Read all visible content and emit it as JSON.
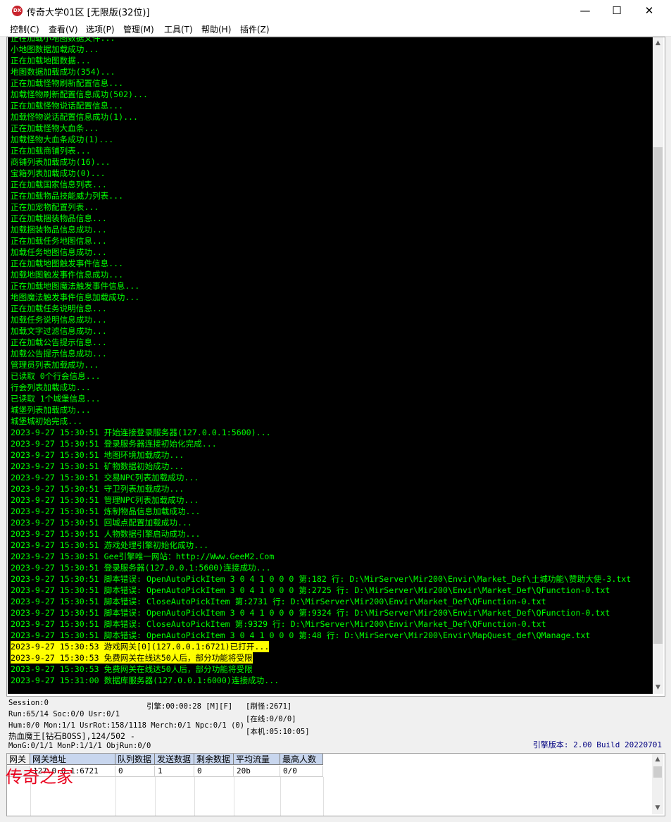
{
  "window": {
    "title": "传奇大学01区 [无限版(32位)]",
    "icon_name": "app-logo-icon",
    "icon_text": "DX",
    "minimize": "—",
    "maximize": "☐",
    "close": "✕"
  },
  "menu": [
    "控制(C)",
    "查看(V)",
    "选项(P)",
    "管理(M)",
    "工具(T)",
    "帮助(H)",
    "插件(Z)"
  ],
  "console_lines": [
    "正在加载小地图数据文件...",
    "小地图数据加载成功...",
    "正在加载地图数据...",
    "地图数据加载成功(354)...",
    "正在加载怪物刷新配置信息...",
    "加载怪物刷新配置信息成功(502)...",
    "正在加载怪物说话配置信息...",
    "加载怪物说话配置信息成功(1)...",
    "正在加载怪物大血条...",
    "加载怪物大血条成功(1)...",
    "正在加载商铺列表...",
    "商铺列表加载成功(16)...",
    "宝箱列表加载成功(0)...",
    "正在加载国家信息列表...",
    "正在加载物品技能威力列表...",
    "正在加宠物配置列表...",
    "正在加载捆装物品信息...",
    "加载捆装物品信息成功...",
    "正在加载任务地图信息...",
    "加载任务地图信息成功...",
    "正在加载地图触发事件信息...",
    "加载地图触发事件信息成功...",
    "正在加载地图魔法触发事件信息...",
    "地图魔法触发事件信息加载成功...",
    "正在加载任务说明信息...",
    "加载任务说明信息成功...",
    "加载文字过滤信息成功...",
    "正在加载公告提示信息...",
    "加载公告提示信息成功...",
    "管理员列表加载成功...",
    "已读取 0个行会信息...",
    "行会列表加载成功...",
    "已读取 1个城堡信息...",
    "城堡列表加载成功...",
    "城堡城初始完成...",
    "2023-9-27 15:30:51 开始连接登录服务器(127.0.0.1:5600)...",
    "2023-9-27 15:30:51 登录服务器连接初始化完成...",
    "2023-9-27 15:30:51 地图环境加载成功...",
    "2023-9-27 15:30:51 矿物数据初始成功...",
    "2023-9-27 15:30:51 交易NPC列表加载成功...",
    "2023-9-27 15:30:51 守卫列表加载成功...",
    "2023-9-27 15:30:51 管理NPC列表加载成功...",
    "2023-9-27 15:30:51 炼制物品信息加载成功...",
    "2023-9-27 15:30:51 回城点配置加载成功...",
    "2023-9-27 15:30:51 人物数据引擎启动成功...",
    "2023-9-27 15:30:51 游戏处理引擎初始化成功...",
    "2023-9-27 15:30:51 Gee引擎唯一网站：http://Www.GeeM2.Com",
    "2023-9-27 15:30:51 登录服务器(127.0.0.1:5600)连接成功...",
    "2023-9-27 15:30:51 脚本错误: OpenAutoPickItem 3 0 4 1 0 0 0 第:182 行: D:\\MirServer\\Mir200\\Envir\\Market_Def\\土城功能\\赞助大使-3.txt",
    "2023-9-27 15:30:51 脚本错误: OpenAutoPickItem 3 0 4 1 0 0 0 第:2725 行: D:\\MirServer\\Mir200\\Envir\\Market_Def\\QFunction-0.txt",
    "2023-9-27 15:30:51 脚本错误: CloseAutoPickItem 第:2731 行: D:\\MirServer\\Mir200\\Envir\\Market_Def\\QFunction-0.txt",
    "2023-9-27 15:30:51 脚本错误: OpenAutoPickItem 3 0 4 1 0 0 0 第:9324 行: D:\\MirServer\\Mir200\\Envir\\Market_Def\\QFunction-0.txt",
    "2023-9-27 15:30:51 脚本错误: CloseAutoPickItem 第:9329 行: D:\\MirServer\\Mir200\\Envir\\Market_Def\\QFunction-0.txt",
    "2023-9-27 15:30:51 脚本错误: OpenAutoPickItem 3 0 4 1 0 0 0 第:48 行: D:\\MirServer\\Mir200\\Envir\\MapQuest_def\\QManage.txt",
    "2023-9-27 15:30:53 游戏网关[0](127.0.0.1:6721)已打开...",
    "2023-9-27 15:30:53 免费网关在线达50人后，部分功能将受限",
    "2023-9-27 15:30:53 免费网关在线达50人后，部分功能将受限",
    "2023-9-27 15:31:00 数据库服务器(127.0.0.1:6000)连接成功..."
  ],
  "highlighted_lines": [
    54,
    55
  ],
  "status": {
    "session": "Session:0",
    "run": "Run:65/14 Soc:0/0 Usr:0/1",
    "hum": "Hum:0/0 Mon:1/1 UsrRot:158/1118 Merch:0/1 Npc:0/1 (0)",
    "boss": "热血魔王[钻石BOSS],124/502 -",
    "mong": "MonG:0/1/1 MonP:1/1/1 ObjRun:0/0",
    "engine_time": "引擎:00:00:28 [M][F]",
    "refresh_monster": "[刷怪:2671]",
    "online": "[在线:0/0/0]",
    "local_time": "[本机:05:10:05]",
    "version": "引擎版本: 2.00 Build 20220701"
  },
  "grid": {
    "headers": [
      "网关",
      "网关地址",
      "队列数据",
      "发送数据",
      "剩余数据",
      "平均流量",
      "最高人数"
    ],
    "rows": [
      [
        "",
        "127.0.0.1:6721",
        "0",
        "1",
        "0",
        "20b",
        "0/0"
      ]
    ]
  },
  "watermark": "传奇之家",
  "colors": {
    "console_bg": "#000000",
    "console_text": "#00ff00",
    "highlight": "#ffff00",
    "watermark": "#e8001c"
  }
}
